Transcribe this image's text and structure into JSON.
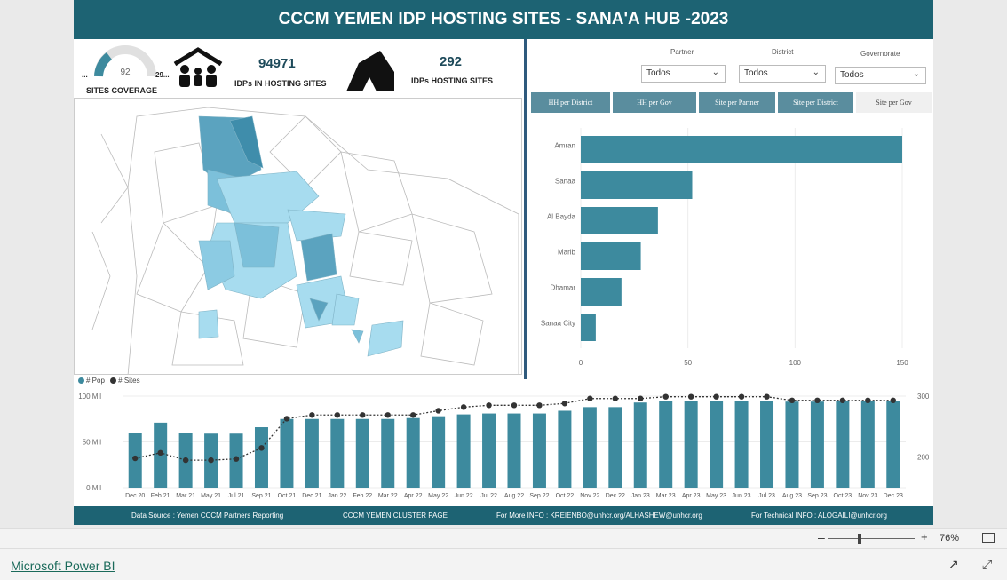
{
  "title": "CCCM YEMEN IDP HOSTING SITES - SANA'A HUB -2023",
  "kpis": {
    "gauge_value": "92",
    "gauge_min": "...",
    "gauge_max": "29...",
    "gauge_label": "SITES COVERAGE",
    "idps_value": "94971",
    "idps_label": "IDPs IN HOSTING SITES",
    "sites_value": "292",
    "sites_label": "IDPs  HOSTING SITES"
  },
  "slicers": [
    {
      "label": "Partner",
      "value": "Todos"
    },
    {
      "label": "District",
      "value": "Todos"
    },
    {
      "label": "Governorate",
      "value": "Todos"
    }
  ],
  "tabs": [
    "HH per District",
    "HH per Gov",
    "Site per Partner",
    "Site per District",
    "Site per Gov"
  ],
  "active_tab": "Site per Gov",
  "legend": {
    "pop": "# Pop",
    "sites": "# Sites"
  },
  "footer": {
    "source": "Data Source : Yemen CCCM Partners Reporting",
    "cluster": "CCCM YEMEN CLUSTER PAGE",
    "info": "For More INFO : KREIENBO@unhcr.org/ALHASHEW@unhcr.org",
    "tech": "For Technical INFO : ALOGAILI@unhcr.org"
  },
  "zoom": "76%",
  "powerbi_link": "Microsoft Power BI",
  "colors": {
    "header": "#1d6373",
    "bar": "#3d8a9e",
    "tab": "#5a8d9e",
    "map_dark": "#5ba3bf",
    "map_light": "#a7dcef"
  },
  "chart_data": [
    {
      "type": "bar",
      "orientation": "horizontal",
      "categories": [
        "Amran",
        "Sanaa",
        "Al Bayda",
        "Marib",
        "Dhamar",
        "Sanaa City"
      ],
      "values": [
        150,
        52,
        36,
        28,
        19,
        7
      ],
      "xlim": [
        0,
        150
      ],
      "xticks": [
        "0",
        "50",
        "100",
        "150"
      ],
      "grid": true
    },
    {
      "type": "bar+line",
      "categories": [
        "Dec 20",
        "Feb 21",
        "Mar 21",
        "May 21",
        "Jul 21",
        "Sep 21",
        "Oct 21",
        "Dec 21",
        "Jan 22",
        "Feb 22",
        "Mar 22",
        "Apr 22",
        "May 22",
        "Jun 22",
        "Jul 22",
        "Aug 22",
        "Sep 22",
        "Oct 22",
        "Nov 22",
        "Dec 22",
        "Jan 23",
        "Mar 23",
        "Apr 23",
        "May 23",
        "Jun 23",
        "Jul 23",
        "Aug 23",
        "Sep 23",
        "Oct 23",
        "Nov 23",
        "Dec 23"
      ],
      "series": [
        {
          "name": "# Pop",
          "axis": "left",
          "values": [
            60000,
            71000,
            60000,
            59000,
            59000,
            66000,
            75000,
            75000,
            75000,
            75000,
            75000,
            76000,
            78000,
            80000,
            81000,
            81000,
            81000,
            84000,
            88000,
            88000,
            93000,
            95000,
            95000,
            95000,
            95000,
            95000,
            94000,
            94000,
            95000,
            95000,
            95000
          ]
        },
        {
          "name": "# Sites",
          "axis": "right",
          "values": [
            198,
            207,
            195,
            195,
            197,
            215,
            263,
            269,
            269,
            269,
            269,
            269,
            276,
            282,
            285,
            285,
            285,
            288,
            296,
            296,
            296,
            299,
            299,
            299,
            299,
            299,
            293,
            293,
            293,
            293,
            293
          ]
        }
      ],
      "y_left_ticks": [
        "0 Mil",
        "50 Mil",
        "100 Mil"
      ],
      "y_left_lim": [
        0,
        100000
      ],
      "y_right_ticks": [
        "200",
        "300"
      ],
      "y_right_lim": [
        150,
        300
      ]
    }
  ]
}
